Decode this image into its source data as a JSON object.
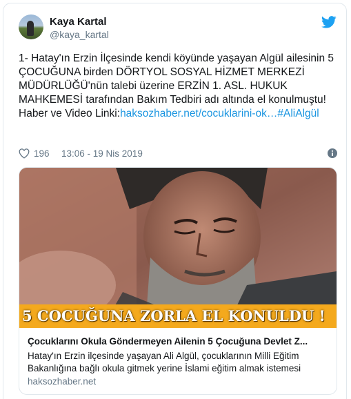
{
  "author": {
    "name": "Kaya Kartal",
    "handle": "@kaya_kartal"
  },
  "tweet": {
    "text": "1- Hatay'ın Erzin İlçesinde kendi köyünde yaşayan Algül ailesinin 5 ÇOCUĞUNA birden DÖRTYOL SOSYAL HİZMET MERKEZİ MÜDÜRLÜĞÜ'nün talebi üzerine ERZİN 1. ASL. HUKUK MAHKEMESİ tarafından Bakım Tedbiri adı altında el konulmuştu!\nHaber ve Video Linki:",
    "link_text": "haksozhaber.net/cocuklarini-ok…",
    "hashtag": "#AliAlgül"
  },
  "meta": {
    "likes": "196",
    "timestamp": "13:06 - 19 Nis 2019"
  },
  "card": {
    "banner": "5 COCUĞUNA ZORLA EL KONULDU !",
    "title": "Çocuklarını Okula Göndermeyen Ailenin 5 Çocuğuna Devlet Z...",
    "description": "Hatay'ın Erzin ilçesinde yaşayan Ali Algül, çocuklarının Milli Eğitim Bakanlığına bağlı okula gitmek yerine İslami eğitim almak istemesi",
    "domain": "haksozhaber.net"
  },
  "colors": {
    "link": "#1b95e0",
    "twitter_blue": "#1da1f2",
    "muted": "#657786",
    "banner_bg": "#f4a91d"
  },
  "icons": [
    "twitter-bird-icon",
    "heart-icon",
    "info-icon"
  ]
}
